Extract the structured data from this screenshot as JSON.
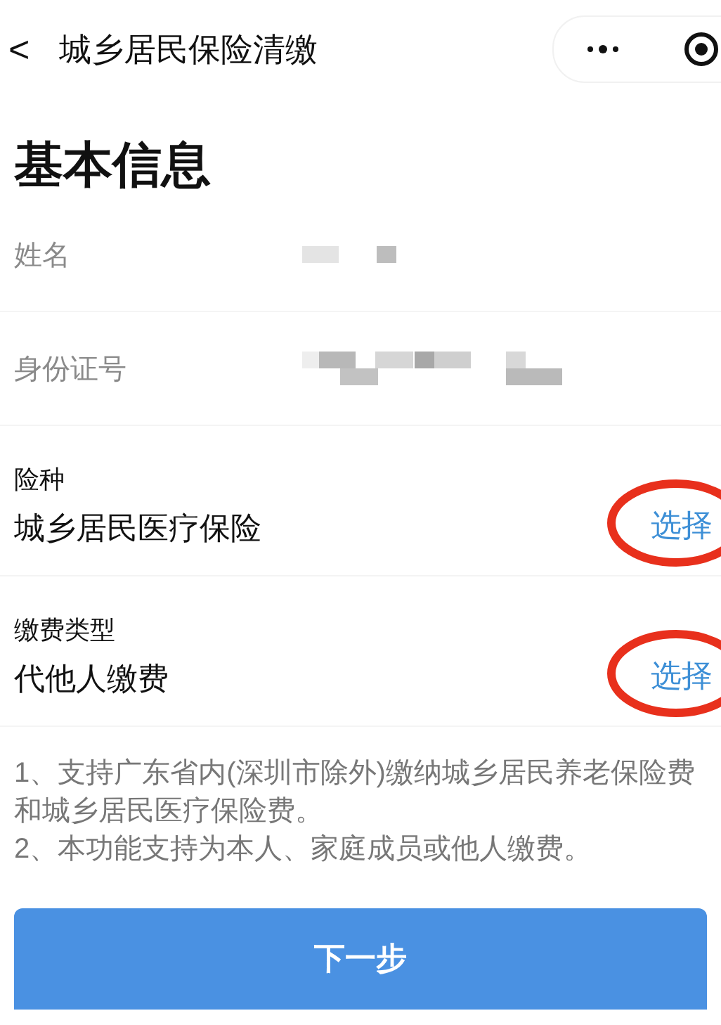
{
  "nav": {
    "back": "<",
    "title": "城乡居民保险清缴"
  },
  "heading": "基本信息",
  "info_rows": [
    {
      "label": "姓名",
      "masked": true,
      "kind": "short"
    },
    {
      "label": "身份证号",
      "masked": true,
      "kind": "long"
    }
  ],
  "select_rows": [
    {
      "label": "险种",
      "value": "城乡居民医疗保险",
      "action": "选择",
      "circled": true
    },
    {
      "label": "缴费类型",
      "value": "代他人缴费",
      "action": "选择",
      "circled": true
    }
  ],
  "notes": [
    "1、支持广东省内(深圳市除外)缴纳城乡居民养老保险费和城乡居民医疗保险费。",
    "2、本功能支持为本人、家庭成员或他人缴费。"
  ],
  "button": "下一步"
}
